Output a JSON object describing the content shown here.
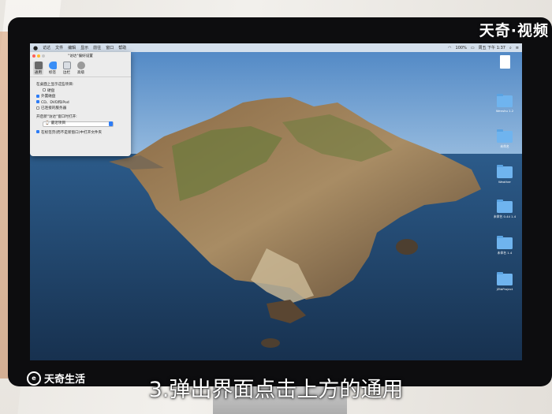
{
  "overlay": {
    "brand_top": "天奇·视频",
    "brand_bottom_logo": "e",
    "brand_bottom": "天奇生活",
    "caption": "3.弹出界面点击上方的通用"
  },
  "menubar": {
    "apple": "",
    "items": [
      "访达",
      "文件",
      "编辑",
      "显示",
      "前往",
      "窗口",
      "帮助"
    ],
    "battery": "100%",
    "clock": "周五 下午 1:37"
  },
  "prefs": {
    "title": "\"访达\"偏好设置",
    "tabs": [
      "通用",
      "标签",
      "边栏",
      "高级"
    ],
    "section_label": "在桌面上显示这些项目:",
    "options": [
      {
        "label": "硬盘",
        "checked": false
      },
      {
        "label": "外置磁盘",
        "checked": true
      },
      {
        "label": "CD、DVD和iPod",
        "checked": true
      },
      {
        "label": "已连接的服务器",
        "checked": false
      }
    ],
    "new_window_label": "开启新\"访达\"窗口时打开:",
    "new_window_value": "最近项目",
    "tabs_option": "在标签页(而不是新窗口)中打开文件夹"
  },
  "desktop_icons": [
    {
      "label": "",
      "kind": "doc"
    },
    {
      "label": "Wenshu 1.2",
      "kind": "folder"
    },
    {
      "label": "未命名",
      "kind": "folder"
    },
    {
      "label": "Weather",
      "kind": "folder"
    },
    {
      "label": "未命名 0.44 1.4",
      "kind": "folder"
    },
    {
      "label": "未命名 1.4",
      "kind": "folder"
    },
    {
      "label": "JZtbProject",
      "kind": "folder"
    }
  ],
  "colors": {
    "accent": "#2d7cf6",
    "folder": "#6fb4ef",
    "sea": "#2f5680",
    "sky": "#8cb6de"
  }
}
